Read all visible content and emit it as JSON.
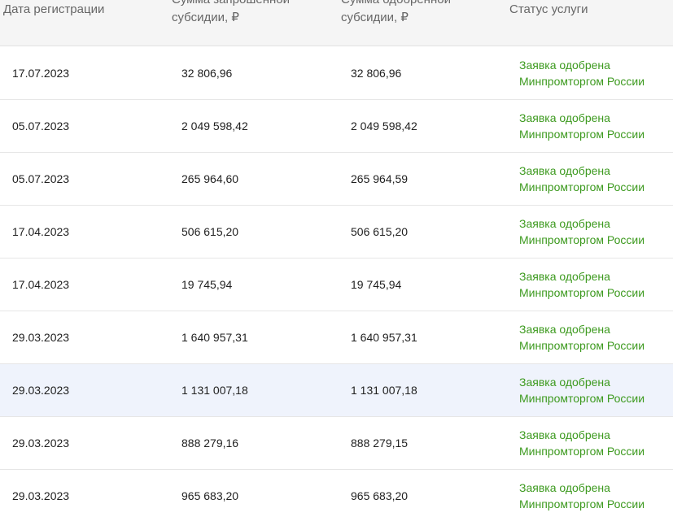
{
  "table": {
    "headers": {
      "date": "Дата регистрации",
      "requested": "Сумма запрошенной субсидии, ₽",
      "approved": "Сумма одобренной субсидии, ₽",
      "status": "Статус услуги"
    },
    "rows": [
      {
        "date": "17.07.2023",
        "requested": "32 806,96",
        "approved": "32 806,96",
        "status": "Заявка одобрена Минпромторгом России"
      },
      {
        "date": "05.07.2023",
        "requested": "2 049 598,42",
        "approved": "2 049 598,42",
        "status": "Заявка одобрена Минпромторгом России"
      },
      {
        "date": "05.07.2023",
        "requested": "265 964,60",
        "approved": "265 964,59",
        "status": "Заявка одобрена Минпромторгом России"
      },
      {
        "date": "17.04.2023",
        "requested": "506 615,20",
        "approved": "506 615,20",
        "status": "Заявка одобрена Минпромторгом России"
      },
      {
        "date": "17.04.2023",
        "requested": "19 745,94",
        "approved": "19 745,94",
        "status": "Заявка одобрена Минпромторгом России"
      },
      {
        "date": "29.03.2023",
        "requested": "1 640 957,31",
        "approved": "1 640 957,31",
        "status": "Заявка одобрена Минпромторгом России"
      },
      {
        "date": "29.03.2023",
        "requested": "1 131 007,18",
        "approved": "1 131 007,18",
        "status": "Заявка одобрена Минпромторгом России"
      },
      {
        "date": "29.03.2023",
        "requested": "888 279,16",
        "approved": "888 279,15",
        "status": "Заявка одобрена Минпромторгом России"
      },
      {
        "date": "29.03.2023",
        "requested": "965 683,20",
        "approved": "965 683,20",
        "status": "Заявка одобрена Минпромторгом России"
      }
    ],
    "highlighted_row": 6,
    "colors": {
      "status_text": "#3d9a1f",
      "header_background": "#f5f5f5",
      "highlight_background": "#eff3fc"
    }
  }
}
